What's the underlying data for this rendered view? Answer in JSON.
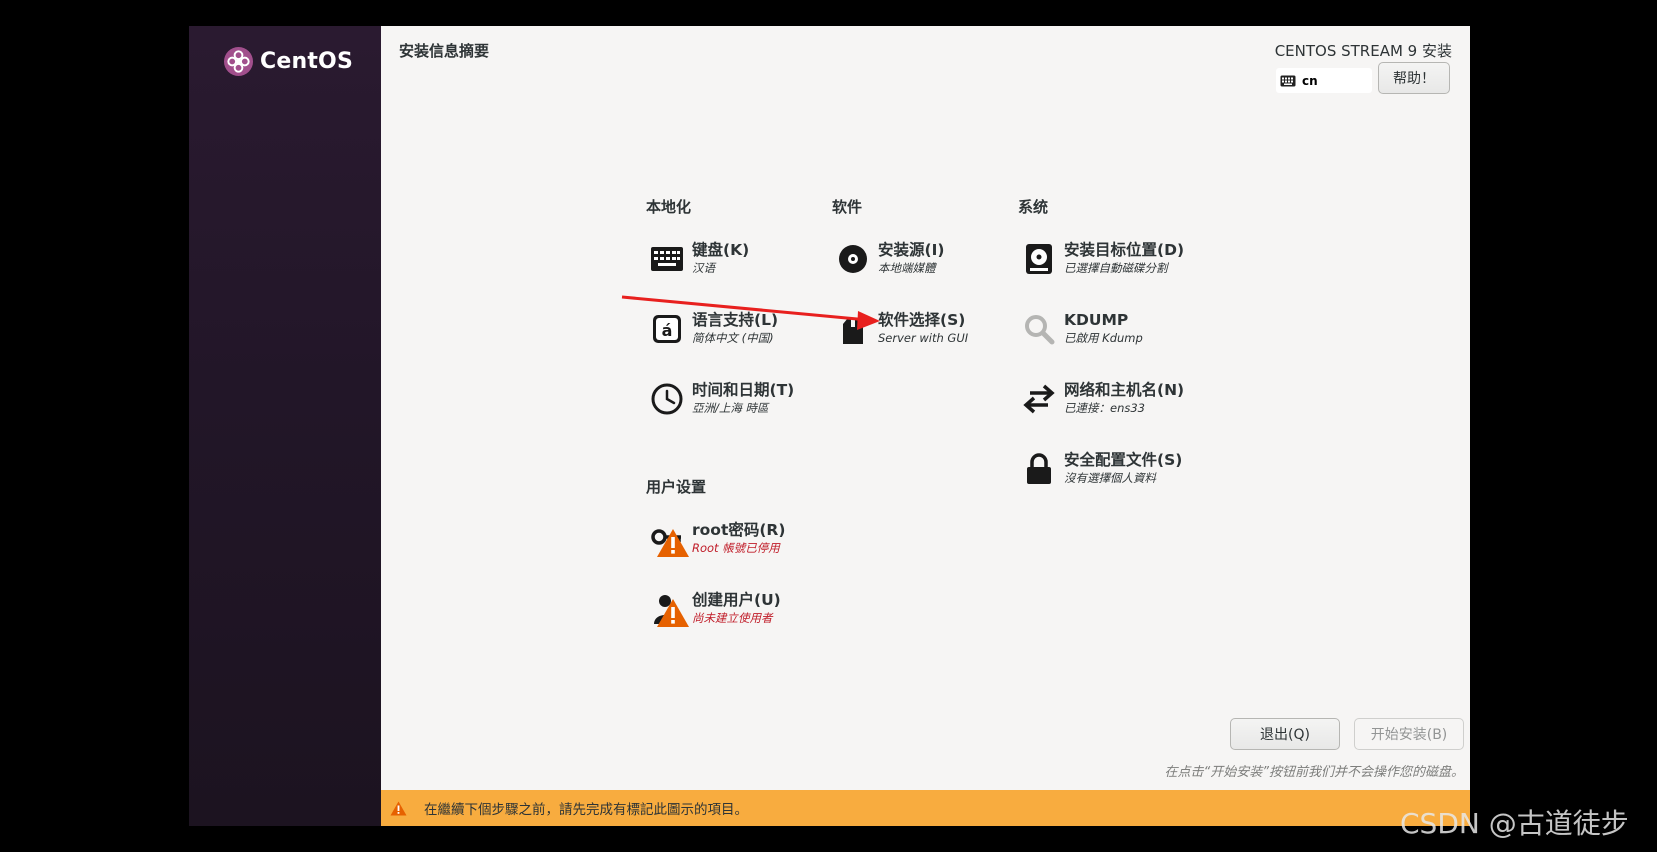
{
  "brand": {
    "name": "CentOS"
  },
  "header": {
    "page_title": "安装信息摘要",
    "product_title": "CENTOS STREAM 9 安装",
    "keyboard_layout": "cn",
    "help_label": "帮助！"
  },
  "sections": {
    "localization": "本地化",
    "software": "软件",
    "system": "系统",
    "user_settings": "用户设置"
  },
  "spokes": {
    "keyboard": {
      "label": "键盘(K)",
      "status": "汉语"
    },
    "language": {
      "label": "语言支持(L)",
      "status": "简体中文 (中国)"
    },
    "datetime": {
      "label": "时间和日期(T)",
      "status": "亞洲/上海 時區"
    },
    "source": {
      "label": "安装源(I)",
      "status": "本地端媒體"
    },
    "software_selection": {
      "label": "软件选择(S)",
      "status": "Server with GUI"
    },
    "destination": {
      "label": "安装目标位置(D)",
      "status": "已選擇自動磁碟分割"
    },
    "kdump": {
      "label": "KDUMP",
      "status": "已啟用 Kdump"
    },
    "network": {
      "label": "网络和主机名(N)",
      "status": "已連接：ens33"
    },
    "security": {
      "label": "安全配置文件(S)",
      "status": "沒有選擇個人資料"
    },
    "root": {
      "label": "root密码(R)",
      "status": "Root 帳號已停用"
    },
    "user": {
      "label": "创建用户(U)",
      "status": "尚未建立使用者"
    }
  },
  "footer": {
    "quit_label": "退出(Q)",
    "begin_label": "开始安装(B)",
    "hint": "在点击“开始安装”按钮前我们并不会操作您的磁盘。",
    "warning": "在繼續下個步驟之前，請先完成有標記此圖示的項目。"
  },
  "watermark": "CSDN @古道徒步",
  "colors": {
    "warning_bar": "#f8ac3f",
    "warning_text": "#c01c28",
    "background": "#f6f5f4",
    "sidebar": "#221628",
    "annotation_arrow": "#e8201e"
  }
}
